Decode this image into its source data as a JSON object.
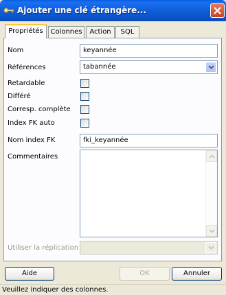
{
  "window": {
    "title": "Ajouter une clé étrangère...",
    "title_icon": "foreign-key-icon",
    "close_icon": "close-icon"
  },
  "tabs": [
    {
      "label": "Propriétés",
      "active": true
    },
    {
      "label": "Colonnes",
      "active": false
    },
    {
      "label": "Action",
      "active": false
    },
    {
      "label": "SQL",
      "active": false
    }
  ],
  "form": {
    "nom_label": "Nom",
    "nom_value": "keyannée",
    "references_label": "Références",
    "references_value": "tabannée",
    "retardable_label": "Retardable",
    "differe_label": "Différé",
    "corresp_label": "Corresp. complète",
    "index_fk_auto_label": "Index FK auto",
    "nom_index_fk_label": "Nom index FK",
    "nom_index_fk_value": "fki_keyannée",
    "commentaires_label": "Commentaires",
    "commentaires_value": "",
    "replication_label": "Utiliser la réplication",
    "replication_value": ""
  },
  "buttons": {
    "aide": "Aide",
    "ok": "OK",
    "annuler": "Annuler"
  },
  "status": {
    "text": "Veuillez indiquer des colonnes."
  },
  "colors": {
    "titlebar": "#0a5fe0",
    "dialog_bg": "#ece9d8",
    "tab_highlight": "#ffc83c",
    "input_border": "#7f9db9"
  }
}
